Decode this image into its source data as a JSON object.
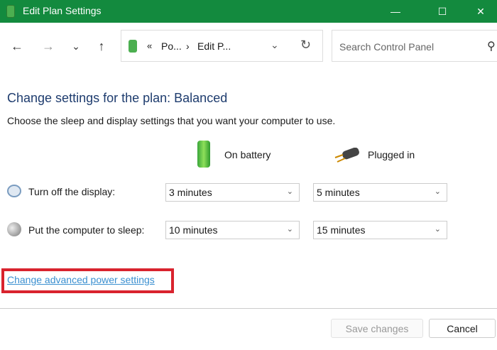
{
  "window": {
    "title": "Edit Plan Settings",
    "minimize": "—",
    "maximize": "☐",
    "close": "✕"
  },
  "nav": {
    "back": "←",
    "forward": "→",
    "recent": "⌄",
    "up": "↑"
  },
  "address": {
    "sep": "«",
    "crumbs": [
      "Po...",
      "Edit P..."
    ],
    "chevron": "›",
    "dropdown": "⌄",
    "refresh": "↻"
  },
  "search": {
    "placeholder": "Search Control Panel",
    "icon": "⚲"
  },
  "main": {
    "title": "Change settings for the plan: Balanced",
    "description": "Choose the sleep and display settings that you want your computer to use.",
    "columns": [
      "On battery",
      "Plugged in"
    ],
    "rows": [
      {
        "label": "Turn off the display:",
        "battery": "3 minutes",
        "plugged": "5 minutes"
      },
      {
        "label": "Put the computer to sleep:",
        "battery": "10 minutes",
        "plugged": "15 minutes"
      }
    ],
    "advanced_link": "Change advanced power settings"
  },
  "footer": {
    "save": "Save changes",
    "cancel": "Cancel"
  },
  "colors": {
    "titlebar": "#138a3e",
    "link": "#3a8fd0",
    "highlight": "#d9232e"
  }
}
